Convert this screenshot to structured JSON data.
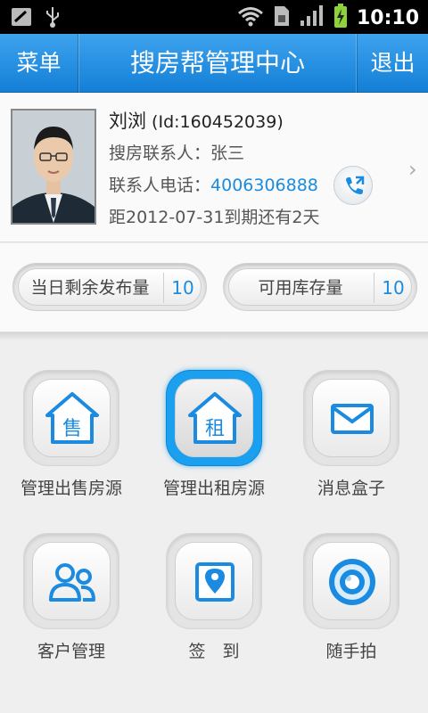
{
  "status_bar": {
    "time": "10:10"
  },
  "header": {
    "menu_label": "菜单",
    "title": "搜房帮管理中心",
    "exit_label": "退出"
  },
  "profile": {
    "name": "刘浏",
    "id_text": "(Id:160452039)",
    "contact_label": "搜房联系人：",
    "contact_name": "张三",
    "phone_label": "联系人电话：",
    "phone": "4006306888",
    "expiry_text": "距2012-07-31到期还有2天"
  },
  "counters": [
    {
      "label": "当日剩余发布量",
      "value": "10"
    },
    {
      "label": "可用库存量",
      "value": "10"
    }
  ],
  "grid": [
    {
      "label": "管理出售房源",
      "icon": "house-sale-icon",
      "icon_char": "售"
    },
    {
      "label": "管理出租房源",
      "icon": "house-rent-icon",
      "icon_char": "租"
    },
    {
      "label": "消息盒子",
      "icon": "mail-icon"
    },
    {
      "label": "客户管理",
      "icon": "customers-icon"
    },
    {
      "label": "签　到",
      "icon": "location-pin-icon"
    },
    {
      "label": "随手拍",
      "icon": "camera-icon"
    }
  ],
  "colors": {
    "accent": "#1a8be0",
    "header": "#2690e2",
    "active_tile": "#1aa0ef"
  }
}
